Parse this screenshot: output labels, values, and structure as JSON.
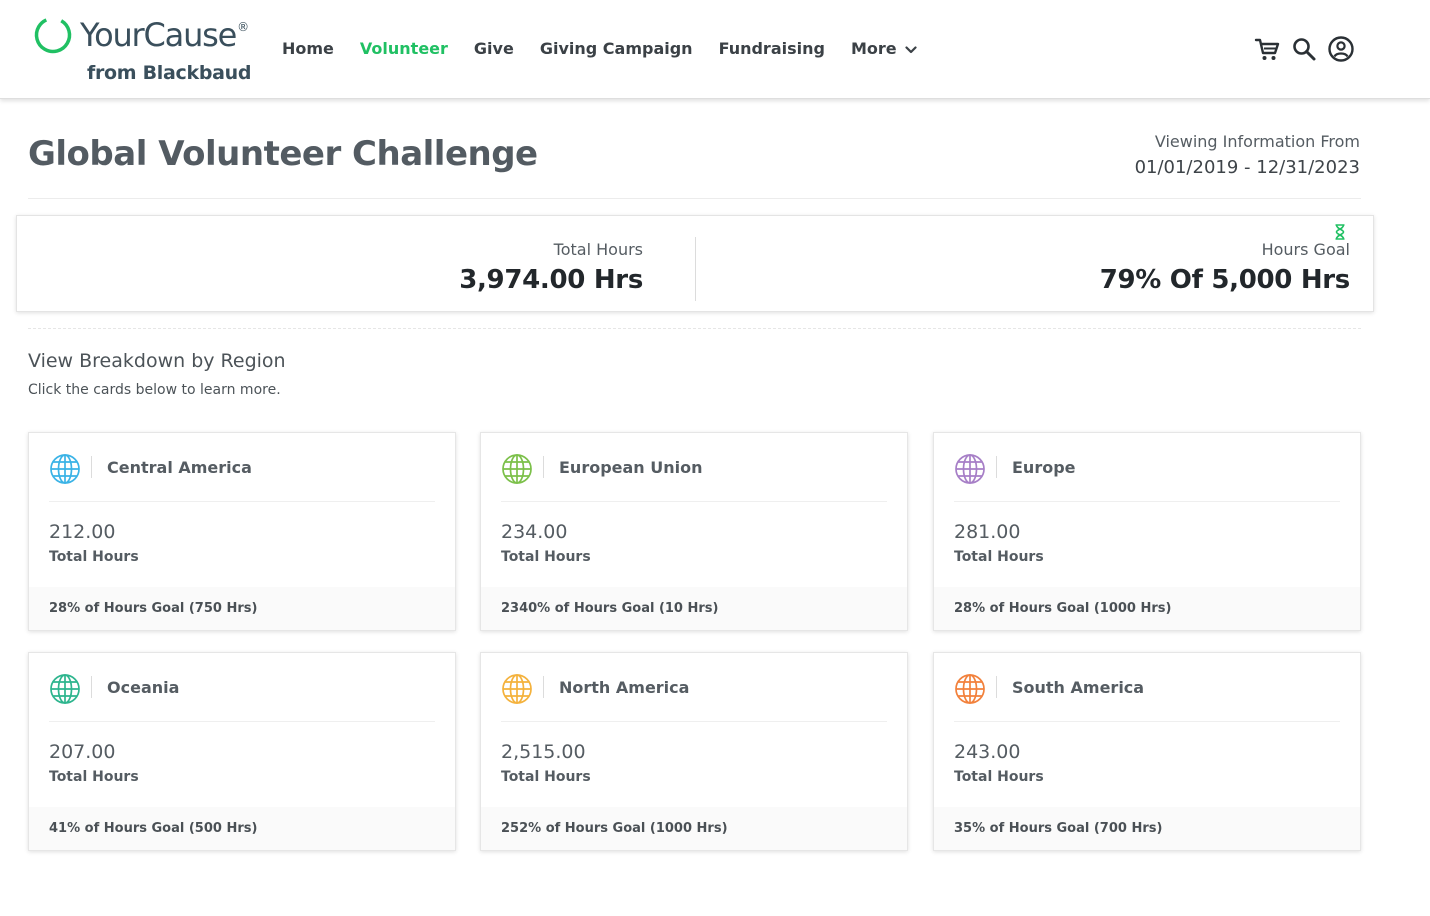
{
  "header": {
    "logo_text": "YourCause",
    "logo_mark": "®",
    "logo_sub": "from Blackbaud",
    "nav": [
      {
        "label": "Home",
        "active": false
      },
      {
        "label": "Volunteer",
        "active": true
      },
      {
        "label": "Give",
        "active": false
      },
      {
        "label": "Giving Campaign",
        "active": false
      },
      {
        "label": "Fundraising",
        "active": false
      },
      {
        "label": "More",
        "active": false
      }
    ],
    "icons": [
      "cart-icon",
      "search-icon",
      "account-icon"
    ],
    "brand_color": "#20c063"
  },
  "page": {
    "title": "Global Volunteer Challenge",
    "date_label": "Viewing Information From",
    "date_range": "01/01/2019 - 12/31/2023"
  },
  "summary": {
    "total_label": "Total Hours",
    "total_value": "3,974.00 Hrs",
    "goal_label": "Hours Goal",
    "goal_value": "79% Of 5,000 Hrs"
  },
  "breakdown": {
    "title": "View Breakdown by Region",
    "subtitle": "Click the cards below to learn more.",
    "cards": [
      {
        "name": "Central America",
        "hours": "212.00",
        "hours_label": "Total Hours",
        "goal": "28% of Hours Goal (750 Hrs)",
        "color": "#3bb3e6"
      },
      {
        "name": "European Union",
        "hours": "234.00",
        "hours_label": "Total Hours",
        "goal": "2340% of Hours Goal (10 Hrs)",
        "color": "#7cc04a"
      },
      {
        "name": "Europe",
        "hours": "281.00",
        "hours_label": "Total Hours",
        "goal": "28% of Hours Goal (1000 Hrs)",
        "color": "#a77fc7"
      },
      {
        "name": "Oceania",
        "hours": "207.00",
        "hours_label": "Total Hours",
        "goal": "41% of Hours Goal (500 Hrs)",
        "color": "#2eb58e"
      },
      {
        "name": "North America",
        "hours": "2,515.00",
        "hours_label": "Total Hours",
        "goal": "252% of Hours Goal (1000 Hrs)",
        "color": "#f4b23d"
      },
      {
        "name": "South America",
        "hours": "243.00",
        "hours_label": "Total Hours",
        "goal": "35% of Hours Goal (700 Hrs)",
        "color": "#f2813c"
      }
    ]
  }
}
